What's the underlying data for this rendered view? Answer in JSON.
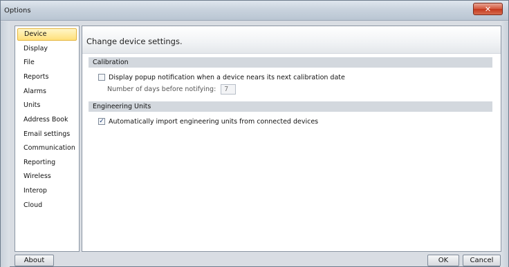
{
  "window": {
    "title": "Options",
    "close_glyph": "✕"
  },
  "nav": {
    "items": [
      {
        "label": "Device",
        "selected": true
      },
      {
        "label": "Display"
      },
      {
        "label": "File"
      },
      {
        "label": "Reports"
      },
      {
        "label": "Alarms"
      },
      {
        "label": "Units"
      },
      {
        "label": "Address Book"
      },
      {
        "label": "Email settings"
      },
      {
        "label": "Communication"
      },
      {
        "label": "Reporting"
      },
      {
        "label": "Wireless"
      },
      {
        "label": "Interop"
      },
      {
        "label": "Cloud"
      }
    ]
  },
  "content": {
    "title": "Change device settings.",
    "calibration": {
      "header": "Calibration",
      "popup_label": "Display popup notification when a device nears its next calibration date",
      "popup_checked": false,
      "days_label": "Number of days before notifying:",
      "days_value": "7"
    },
    "engineering": {
      "header": "Engineering Units",
      "import_label": "Automatically import engineering units from connected devices",
      "import_checked": true
    }
  },
  "footer": {
    "about_label": "About",
    "ok_label": "OK",
    "cancel_label": "Cancel"
  },
  "icons": {
    "check_glyph": "✓"
  }
}
